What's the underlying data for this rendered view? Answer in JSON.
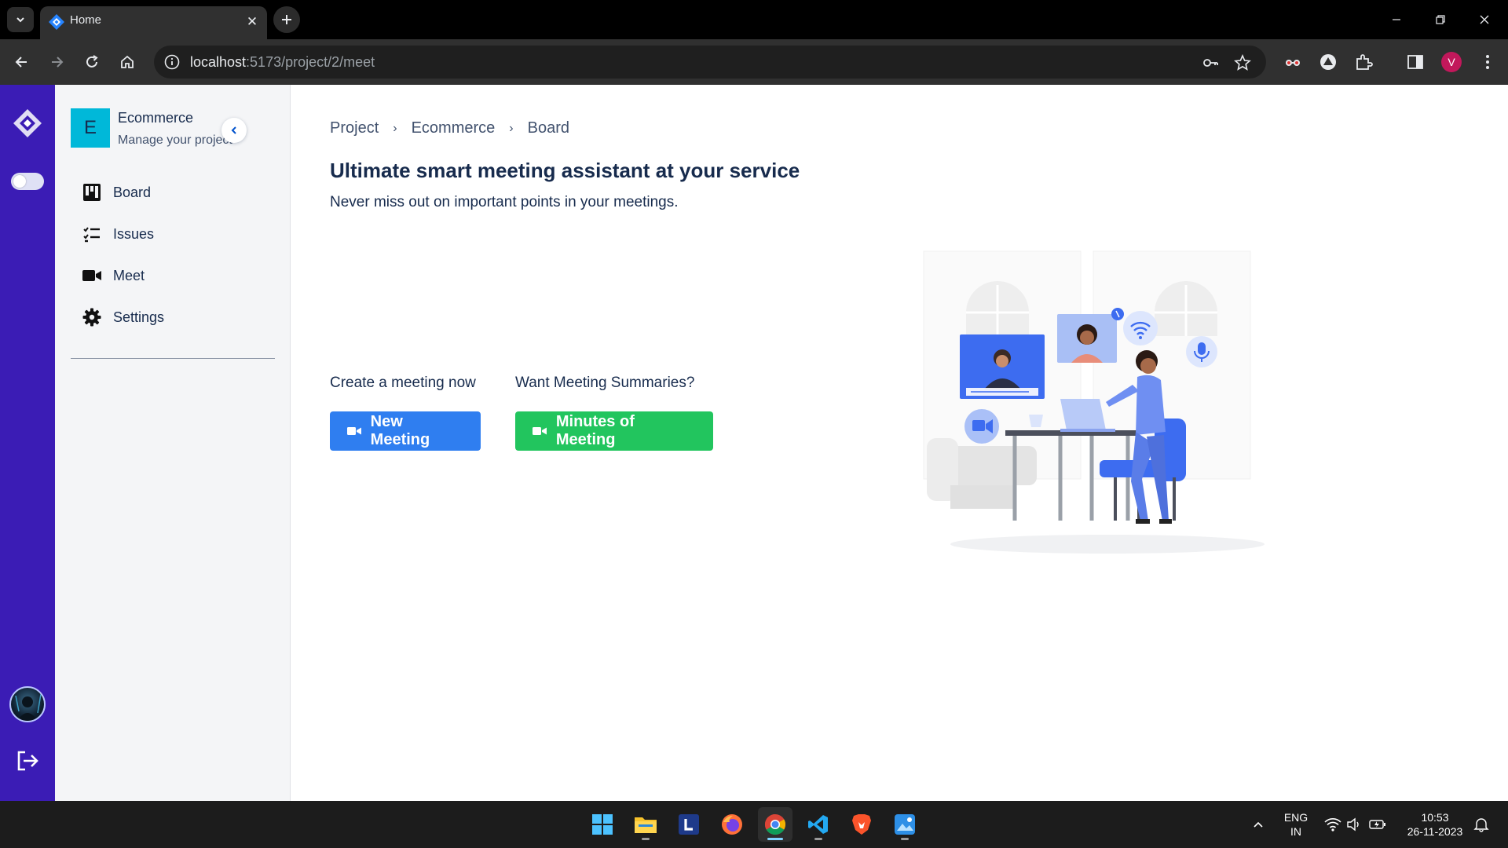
{
  "browser": {
    "tab_title": "Home",
    "url_host": "localhost",
    "url_rest": ":5173/project/2/meet",
    "profile_initial": "V",
    "profile_color": "#c2185b"
  },
  "rail": {
    "accent_color": "#3b1cb5"
  },
  "project": {
    "avatar_letter": "E",
    "name": "Ecommerce",
    "subtitle": "Manage your project"
  },
  "sidebar": {
    "items": [
      {
        "label": "Board",
        "icon": "board-icon"
      },
      {
        "label": "Issues",
        "icon": "issues-icon"
      },
      {
        "label": "Meet",
        "icon": "video-icon"
      },
      {
        "label": "Settings",
        "icon": "gear-icon"
      }
    ]
  },
  "breadcrumb": {
    "items": [
      "Project",
      "Ecommerce",
      "Board"
    ],
    "separator": "›"
  },
  "main": {
    "title": "Ultimate smart meeting assistant at your service",
    "subtitle": "Never miss out on important points in your meetings."
  },
  "actions": {
    "create_label": "Create a meeting now",
    "summary_label": "Want Meeting Summaries?",
    "new_meeting_button": "New Meeting",
    "minutes_button": "Minutes of Meeting",
    "new_meeting_color": "#2f7ef0",
    "minutes_color": "#22c55e"
  },
  "taskbar": {
    "language_line1": "ENG",
    "language_line2": "IN",
    "time": "10:53",
    "date": "26-11-2023",
    "apps": [
      "windows-start-icon",
      "file-explorer-icon",
      "l-app-icon",
      "firefox-icon",
      "chrome-icon",
      "vscode-icon",
      "brave-icon",
      "photos-icon"
    ]
  }
}
